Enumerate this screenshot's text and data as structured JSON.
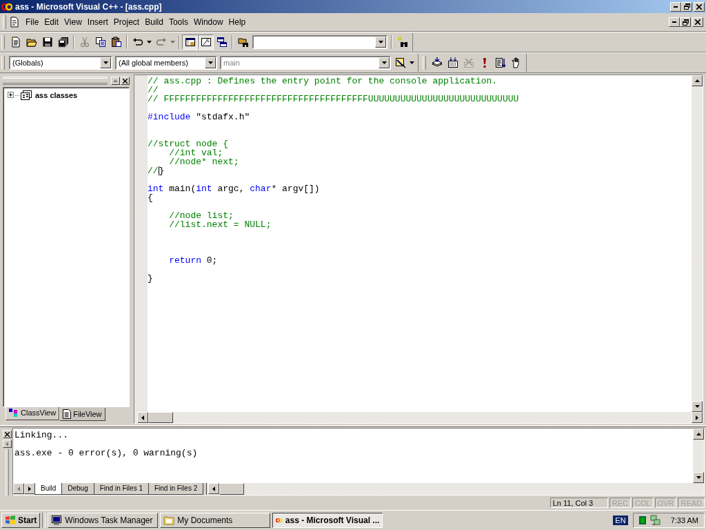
{
  "window": {
    "title": "ass - Microsoft Visual C++ - [ass.cpp]"
  },
  "menu": [
    "File",
    "Edit",
    "View",
    "Insert",
    "Project",
    "Build",
    "Tools",
    "Window",
    "Help"
  ],
  "toolbar": {
    "groups": [
      {
        "buttons": [
          {
            "kind": "new",
            "disabled": false,
            "pressed": false
          },
          {
            "kind": "open",
            "disabled": false,
            "pressed": false
          },
          {
            "kind": "save",
            "disabled": false,
            "pressed": false
          },
          {
            "kind": "saveall",
            "disabled": false,
            "pressed": false
          }
        ]
      },
      {
        "buttons": [
          {
            "kind": "cut",
            "disabled": true,
            "pressed": false
          },
          {
            "kind": "copy",
            "disabled": false,
            "pressed": false
          },
          {
            "kind": "paste",
            "disabled": false,
            "pressed": false
          }
        ]
      },
      {
        "buttons": [
          {
            "kind": "undo",
            "disabled": false,
            "pressed": false
          },
          {
            "kind": "drop",
            "disabled": false,
            "pressed": false
          },
          {
            "kind": "redo",
            "disabled": true,
            "pressed": false
          },
          {
            "kind": "drop",
            "disabled": true,
            "pressed": false
          }
        ]
      },
      {
        "buttons": [
          {
            "kind": "workspace",
            "disabled": false,
            "pressed": true
          },
          {
            "kind": "output",
            "disabled": false,
            "pressed": true
          },
          {
            "kind": "windows",
            "disabled": false,
            "pressed": false
          }
        ]
      },
      {
        "buttons": [
          {
            "kind": "findfiles",
            "disabled": false,
            "pressed": false
          }
        ]
      }
    ],
    "find_buttons": [
      {
        "kind": "find",
        "disabled": false,
        "pressed": false
      }
    ]
  },
  "wizard_bar": {
    "combos": [
      {
        "value": "(Globals)",
        "disabled": false
      },
      {
        "value": "(All global members)",
        "disabled": false
      },
      {
        "value": "main",
        "disabled": true
      }
    ],
    "buttons": [
      {
        "kind": "wizard",
        "disabled": false,
        "pressed": false
      },
      {
        "kind": "drop",
        "disabled": false,
        "pressed": false
      }
    ]
  },
  "build_toolbar": {
    "buttons": [
      {
        "kind": "compile",
        "disabled": false,
        "pressed": false
      },
      {
        "kind": "build",
        "disabled": false,
        "pressed": false
      },
      {
        "kind": "stop",
        "disabled": true,
        "pressed": false
      },
      {
        "kind": "execute",
        "disabled": false,
        "pressed": false
      },
      {
        "kind": "list",
        "disabled": false,
        "pressed": false
      },
      {
        "kind": "hand",
        "disabled": false,
        "pressed": false
      }
    ]
  },
  "workspace": {
    "tree": [
      {
        "label": "ass classes",
        "expanded": false
      }
    ],
    "tabs": [
      {
        "label": "ClassView",
        "selected": true
      },
      {
        "label": "FileView",
        "selected": false
      }
    ]
  },
  "editor": {
    "lines": [
      {
        "kind": "code",
        "segments": [
          {
            "text": "// ass.cpp : Defines the entry point for the console application.",
            "kind": "comment"
          }
        ]
      },
      {
        "kind": "code",
        "segments": [
          {
            "text": "//",
            "kind": "comment"
          }
        ]
      },
      {
        "kind": "code",
        "segments": [
          {
            "text": "// FFFFFFFFFFFFFFFFFFFFFFFFFFFFFFFFFFFFFFUUUUUUUUUUUUUUUUUUUUUUUUUUUU",
            "kind": "comment"
          }
        ]
      },
      {
        "kind": "blank"
      },
      {
        "kind": "code",
        "segments": [
          {
            "text": "#include",
            "kind": "keyword"
          },
          {
            "text": " \"stdafx.h\"",
            "kind": "plain"
          }
        ]
      },
      {
        "kind": "blank"
      },
      {
        "kind": "blank"
      },
      {
        "kind": "code",
        "segments": [
          {
            "text": "//struct node {",
            "kind": "comment"
          }
        ]
      },
      {
        "kind": "code",
        "segments": [
          {
            "text": "    //int val;",
            "kind": "comment"
          }
        ]
      },
      {
        "kind": "code",
        "segments": [
          {
            "text": "    //node* next;",
            "kind": "comment"
          }
        ]
      },
      {
        "kind": "code",
        "segments": [
          {
            "text": "//",
            "kind": "comment",
            "caret_after": true
          },
          {
            "text": "}",
            "kind": "plain"
          }
        ]
      },
      {
        "kind": "blank"
      },
      {
        "kind": "code",
        "segments": [
          {
            "text": "int",
            "kind": "keyword"
          },
          {
            "text": " main(",
            "kind": "plain"
          },
          {
            "text": "int",
            "kind": "keyword"
          },
          {
            "text": " argc, ",
            "kind": "plain"
          },
          {
            "text": "char",
            "kind": "keyword"
          },
          {
            "text": "* argv[])",
            "kind": "plain"
          }
        ]
      },
      {
        "kind": "code",
        "segments": [
          {
            "text": "{",
            "kind": "plain"
          }
        ]
      },
      {
        "kind": "blank"
      },
      {
        "kind": "code",
        "segments": [
          {
            "text": "    //node list;",
            "kind": "comment"
          }
        ]
      },
      {
        "kind": "code",
        "segments": [
          {
            "text": "    //list.next = NULL;",
            "kind": "comment"
          }
        ]
      },
      {
        "kind": "blank"
      },
      {
        "kind": "blank"
      },
      {
        "kind": "blank"
      },
      {
        "kind": "code",
        "segments": [
          {
            "text": "    return",
            "kind": "keyword"
          },
          {
            "text": " 0;",
            "kind": "plain"
          }
        ]
      },
      {
        "kind": "blank"
      },
      {
        "kind": "code",
        "segments": [
          {
            "text": "}",
            "kind": "plain"
          }
        ]
      }
    ]
  },
  "output": {
    "lines": [
      {
        "kind": "text",
        "text": "Linking..."
      },
      {
        "kind": "blank"
      },
      {
        "kind": "text",
        "text": "ass.exe - 0 error(s), 0 warning(s)"
      }
    ],
    "tabs": [
      {
        "label": "Build",
        "selected": true
      },
      {
        "label": "Debug",
        "selected": false
      },
      {
        "label": "Find in Files 1",
        "selected": false
      },
      {
        "label": "Find in Files 2",
        "selected": false
      }
    ]
  },
  "status_bar": {
    "position": "Ln 11, Col 3",
    "indicators": [
      {
        "label": "REC",
        "on": false
      },
      {
        "label": "COL",
        "on": false
      },
      {
        "label": "OVR",
        "on": false
      },
      {
        "label": "READ",
        "on": false
      }
    ]
  },
  "taskbar": {
    "start": "Start",
    "tasks": [
      {
        "label": "Windows Task Manager",
        "selected": false,
        "kind": "monitor"
      },
      {
        "label": "My Documents",
        "selected": false,
        "kind": "folder"
      },
      {
        "label": "ass - Microsoft Visual ...",
        "selected": true,
        "kind": "vc"
      }
    ],
    "language": "EN",
    "clock": "7:33 AM"
  }
}
